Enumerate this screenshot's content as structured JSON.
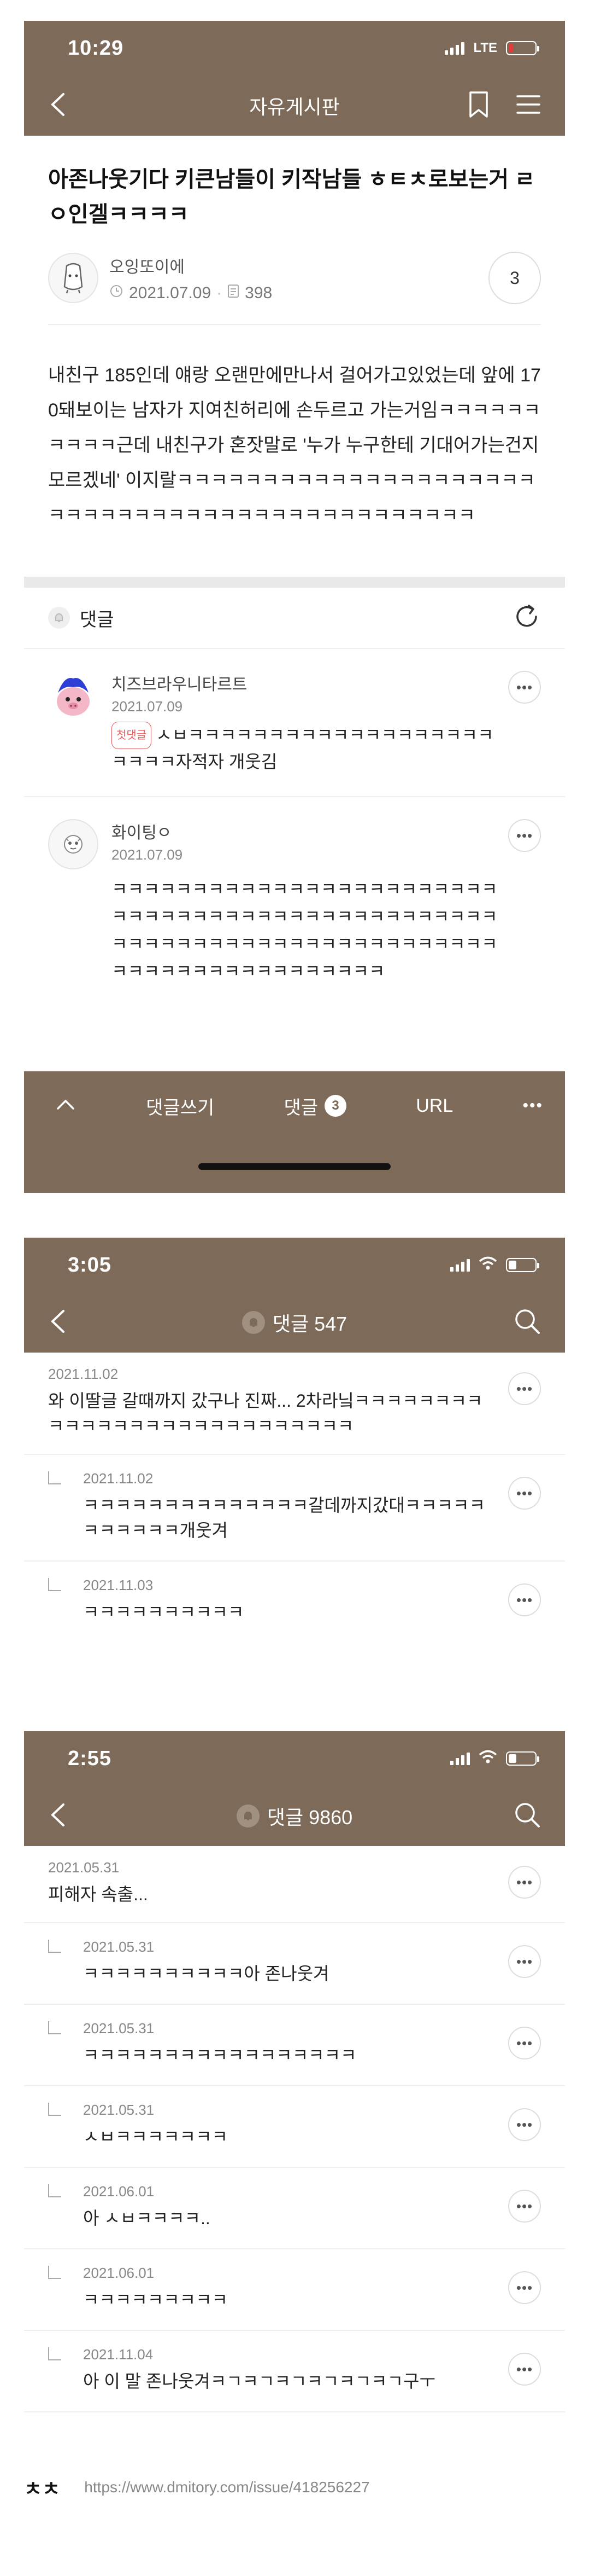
{
  "colors": {
    "nav_brown": "#7d6a58",
    "first_badge": "#e55d5d",
    "battery_low": "#e53a3a"
  },
  "screen1": {
    "status": {
      "time": "10:29",
      "network": "LTE"
    },
    "nav": {
      "title": "자유게시판"
    },
    "post": {
      "title": "아존나웃기다 키큰남들이 키작남들 ㅎㅌㅊ로보는거 ㄹㅇ인겔ㅋㅋㅋㅋ",
      "author": "오잉또이에",
      "date": "2021.07.09",
      "views": "398",
      "comment_count": "3",
      "body": "내친구 185인데 얘랑 오랜만에만나서 걸어가고있었는데 앞에 170돼보이는 남자가 지여친허리에 손두르고 가는거임ㅋㅋㅋㅋㅋㅋㅋㅋㅋㅋ근데 내친구가 혼잣말로 '누가 누구한테 기대어가는건지 모르겠네' 이지랄ㅋㅋㅋㅋㅋㅋㅋㅋㅋㅋㅋㅋㅋㅋㅋㅋㅋㅋㅋㅋㅋㅋㅋㅋㅋㅋㅋㅋㅋㅋㅋㅋㅋㅋㅋㅋㅋㅋㅋㅋㅋㅋㅋㅋㅋㅋ"
    },
    "comments_header": {
      "label": "댓글"
    },
    "comments": [
      {
        "name": "치즈브라우니타르트",
        "date": "2021.07.09",
        "badge": "첫댓글",
        "text": "ㅅㅂㅋㅋㅋㅋㅋㅋㅋㅋㅋㅋㅋㅋㅋㅋㅋㅋㅋㅋㅋㅋㅋㅋㅋ자적자 개웃김"
      },
      {
        "name": "화이팅ㅇ",
        "date": "2021.07.09",
        "text": "ㅋㅋㅋㅋㅋㅋㅋㅋㅋㅋㅋㅋㅋㅋㅋㅋㅋㅋㅋㅋㅋㅋㅋㅋㅋㅋㅋㅋㅋㅋㅋㅋㅋㅋㅋㅋㅋㅋㅋㅋㅋㅋㅋㅋㅋㅋㅋㅋㅋㅋㅋㅋㅋㅋㅋㅋㅋㅋㅋㅋㅋㅋㅋㅋㅋㅋㅋㅋㅋㅋㅋㅋㅋㅋㅋㅋㅋㅋㅋㅋㅋㅋㅋㅋㅋㅋㅋㅋㅋ"
      }
    ],
    "bottom_bar": {
      "write": "댓글쓰기",
      "comments": "댓글",
      "comments_count": "3",
      "url": "URL"
    }
  },
  "screen2": {
    "status": {
      "time": "3:05"
    },
    "nav": {
      "title": "댓글 547"
    },
    "comments": [
      {
        "date": "2021.11.02",
        "text": "와 이딸글 갈때까지 갔구나 진짜... 2차라닠ㅋㅋㅋㅋㅋㅋㅋㅋㅋㅋㅋㅋㅋㅋㅋㅋㅋㅋㅋㅋㅋㅋㅋㅋㅋㅋㅋ",
        "reply": false
      },
      {
        "date": "2021.11.02",
        "text": "ㅋㅋㅋㅋㅋㅋㅋㅋㅋㅋㅋㅋㅋㅋ갈데까지갔대ㅋㅋㅋㅋㅋㅋㅋㅋㅋㅋㅋ개웃겨",
        "reply": true
      },
      {
        "date": "2021.11.03",
        "text": "ㅋㅋㅋㅋㅋㅋㅋㅋㅋㅋ",
        "reply": true
      }
    ]
  },
  "screen3": {
    "status": {
      "time": "2:55"
    },
    "nav": {
      "title": "댓글 9860"
    },
    "comments": [
      {
        "date": "2021.05.31",
        "text": "피해자 속출...",
        "reply": false
      },
      {
        "date": "2021.05.31",
        "text": "ㅋㅋㅋㅋㅋㅋㅋㅋㅋㅋ아 존나웃겨",
        "reply": true
      },
      {
        "date": "2021.05.31",
        "text": "ㅋㅋㅋㅋㅋㅋㅋㅋㅋㅋㅋㅋㅋㅋㅋㅋㅋ",
        "reply": true
      },
      {
        "date": "2021.05.31",
        "text": "ㅅㅂㅋㅋㅋㅋㅋㅋㅋ",
        "reply": true
      },
      {
        "date": "2021.06.01",
        "text": "아 ㅅㅂㅋㅋㅋㅋ..",
        "reply": true
      },
      {
        "date": "2021.06.01",
        "text": "ㅋㅋㅋㅋㅋㅋㅋㅋㅋ",
        "reply": true
      },
      {
        "date": "2021.11.04",
        "text": "아 이 말 존나웃겨ㅋㄱㅋㄱㅋㄱㅋㄱㅋㄱㅋㄱ구ㅜ",
        "reply": true
      }
    ]
  },
  "footer": {
    "mark": "ㅊㅊ",
    "url": "https://www.dmitory.com/issue/418256227"
  }
}
